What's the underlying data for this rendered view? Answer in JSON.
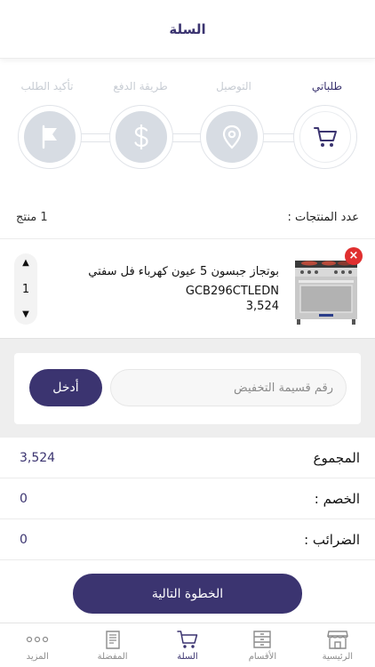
{
  "header": {
    "title": "السلة"
  },
  "steps": [
    {
      "label": "طلباتي",
      "icon": "cart-icon",
      "active": true
    },
    {
      "label": "التوصيل",
      "icon": "location-icon",
      "active": false
    },
    {
      "label": "طريقة الدفع",
      "icon": "dollar-icon",
      "active": false
    },
    {
      "label": "تأكيد الطلب",
      "icon": "flag-icon",
      "active": false
    }
  ],
  "cart": {
    "count_label": "عدد المنتجات :",
    "count_value": "1 منتج"
  },
  "product": {
    "name": "بوتجاز  جبسون 5 عيون كهرباء فل سفتي GCB296CTLEDN",
    "price": "3,524",
    "quantity": "1",
    "remove_symbol": "×"
  },
  "coupon": {
    "placeholder": "رقم قسيمة التخفيض",
    "apply_label": "أدخل"
  },
  "totals": {
    "subtotal_label": "المجموع",
    "subtotal_value": "3,524",
    "discount_label": "الخصم :",
    "discount_value": "0",
    "tax_label": "الضرائب :",
    "tax_value": "0"
  },
  "next_button": "الخطوة التالية",
  "tabs": [
    {
      "label": "الرئيسية",
      "icon": "store-icon",
      "active": false
    },
    {
      "label": "الأقسام",
      "icon": "categories-icon",
      "active": false
    },
    {
      "label": "السلة",
      "icon": "cart-icon",
      "active": true
    },
    {
      "label": "المفضلة",
      "icon": "favorites-icon",
      "active": false
    },
    {
      "label": "المزيد",
      "icon": "more-icon",
      "active": false
    }
  ],
  "colors": {
    "accent": "#3b3470",
    "remove": "#e02f2f",
    "inactive_step": "#d7dce3"
  }
}
